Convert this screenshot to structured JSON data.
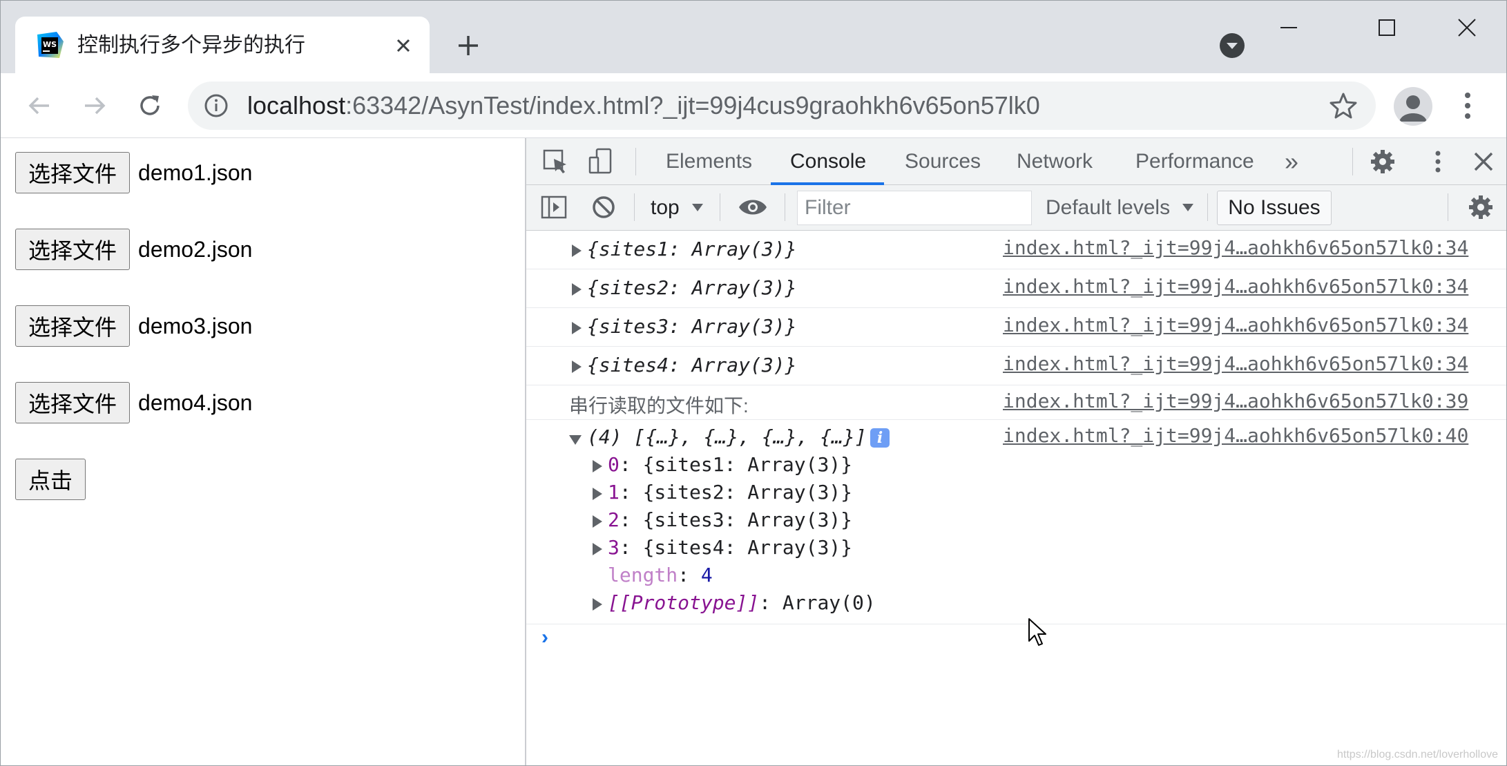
{
  "browser": {
    "tab_title": "控制执行多个异步的执行",
    "favicon_text": "WS",
    "url_host": "localhost",
    "url_rest": ":63342/AsynTest/index.html?_ijt=99j4cus9graohkh6v65on57lk0",
    "icons": [
      "webstorm-favicon",
      "close-icon",
      "plus-icon",
      "tab-search-icon",
      "minimize-icon",
      "maximize-icon",
      "window-close-icon",
      "back-arrow-icon",
      "forward-arrow-icon",
      "reload-icon",
      "info-icon",
      "star-icon",
      "profile-icon",
      "more-vert-icon"
    ]
  },
  "page": {
    "file_inputs": [
      {
        "button": "选择文件",
        "file": "demo1.json"
      },
      {
        "button": "选择文件",
        "file": "demo2.json"
      },
      {
        "button": "选择文件",
        "file": "demo3.json"
      },
      {
        "button": "选择文件",
        "file": "demo4.json"
      }
    ],
    "click_button": "点击"
  },
  "devtools": {
    "tabs": [
      {
        "label": "Elements",
        "active": false
      },
      {
        "label": "Console",
        "active": true
      },
      {
        "label": "Sources",
        "active": false
      },
      {
        "label": "Network",
        "active": false
      },
      {
        "label": "Performance",
        "active": false
      }
    ],
    "more_tabs": "»",
    "context": "top",
    "filter_placeholder": "Filter",
    "levels": "Default levels",
    "issues": "No Issues",
    "accent": "#1a73e8"
  },
  "console": {
    "logs": [
      {
        "text": "{sites1: Array(3)}",
        "source": "index.html?_ijt=99j4…aohkh6v65on57lk0:34"
      },
      {
        "text": "{sites2: Array(3)}",
        "source": "index.html?_ijt=99j4…aohkh6v65on57lk0:34"
      },
      {
        "text": "{sites3: Array(3)}",
        "source": "index.html?_ijt=99j4…aohkh6v65on57lk0:34"
      },
      {
        "text": "{sites4: Array(3)}",
        "source": "index.html?_ijt=99j4…aohkh6v65on57lk0:34"
      }
    ],
    "message": {
      "text": "串行读取的文件如下:",
      "source": "index.html?_ijt=99j4…aohkh6v65on57lk0:39"
    },
    "array_log": {
      "preview": "(4) [{…}, {…}, {…}, {…}]",
      "badge": "i",
      "source": "index.html?_ijt=99j4…aohkh6v65on57lk0:40",
      "items": [
        {
          "key": "0",
          "value": "{sites1: Array(3)}"
        },
        {
          "key": "1",
          "value": "{sites2: Array(3)}"
        },
        {
          "key": "2",
          "value": "{sites3: Array(3)}"
        },
        {
          "key": "3",
          "value": "{sites4: Array(3)}"
        }
      ],
      "length_key": "length",
      "length_value": "4",
      "proto_key": "[[Prototype]]",
      "proto_value": "Array(0)"
    },
    "prompt": "›"
  },
  "watermark": "https://blog.csdn.net/loverhollove"
}
